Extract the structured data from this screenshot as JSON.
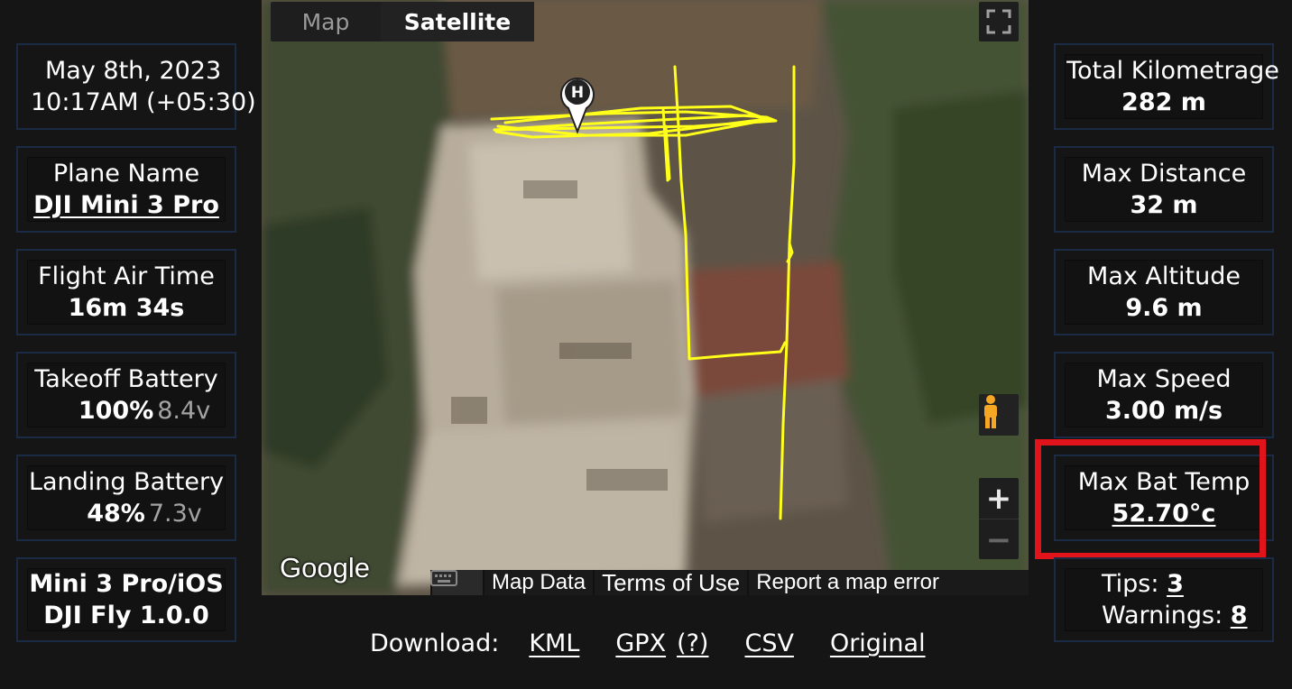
{
  "left_panel": {
    "date": {
      "line1": "May 8th, 2023",
      "line2": "10:17AM (+05:30)"
    },
    "plane": {
      "label": "Plane Name",
      "value": "DJI Mini 3 Pro"
    },
    "air_time": {
      "label": "Flight Air Time",
      "value": "16m 34s"
    },
    "takeoff_battery": {
      "label": "Takeoff Battery",
      "percent": "100%",
      "voltage": "8.4v"
    },
    "landing_battery": {
      "label": "Landing Battery",
      "percent": "48%",
      "voltage": "7.3v"
    },
    "app": {
      "line1": "Mini 3 Pro/iOS",
      "line2": "DJI Fly 1.0.0"
    }
  },
  "right_panel": {
    "total_km": {
      "label": "Total Kilometrage",
      "value": "282 m"
    },
    "max_distance": {
      "label": "Max Distance",
      "value": "32 m"
    },
    "max_altitude": {
      "label": "Max Altitude",
      "value": "9.6 m"
    },
    "max_speed": {
      "label": "Max Speed",
      "value": "3.00 m/s"
    },
    "max_bat_temp": {
      "label": "Max Bat Temp",
      "value": "52.70°c"
    },
    "tips": {
      "label": "Tips:",
      "value": "3"
    },
    "warnings": {
      "label": "Warnings:",
      "value": "8"
    }
  },
  "map": {
    "type_map": "Map",
    "type_satellite": "Satellite",
    "selected_type": "Satellite",
    "zoom_in": "+",
    "zoom_out": "−",
    "home_marker": "H",
    "google_logo": "Google",
    "attribution": {
      "map_data": "Map Data",
      "terms": "Terms of Use",
      "report": "Report a map error"
    },
    "path_color": "#ffff1a"
  },
  "download": {
    "label": "Download:",
    "links": [
      "KML",
      "GPX",
      "(?)",
      "CSV",
      "Original"
    ]
  },
  "colors": {
    "highlight": "#e0141a",
    "card_border": "#1c2b45",
    "background": "#151515"
  }
}
